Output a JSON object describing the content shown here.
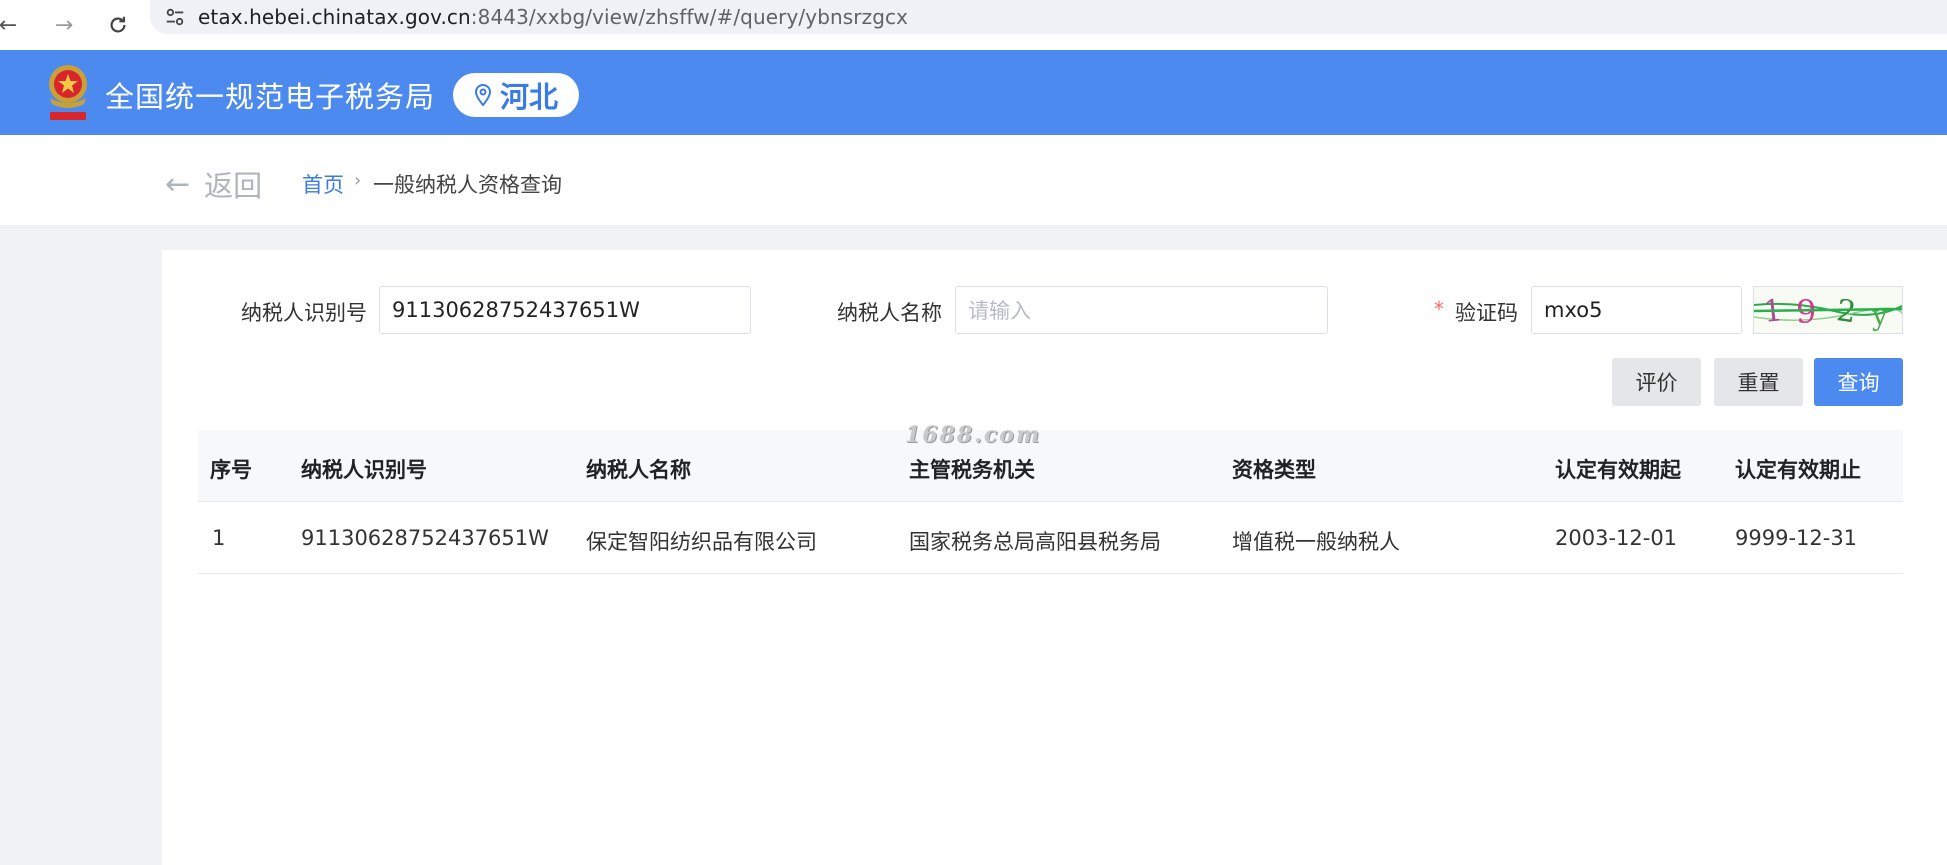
{
  "browser": {
    "url_host": "etax.hebei.chinatax.gov.cn",
    "url_path": ":8443/xxbg/view/zhsffw/#/query/ybnsrzgcx"
  },
  "header": {
    "title": "全国统一规范电子税务局",
    "region": "河北"
  },
  "breadcrumb": {
    "back_label": "返回",
    "home": "首页",
    "separator": "›",
    "current": "一般纳税人资格查询"
  },
  "form": {
    "taxpayer_id_label": "纳税人识别号",
    "taxpayer_id_value": "91130628752437651W",
    "taxpayer_name_label": "纳税人名称",
    "taxpayer_name_placeholder": "请输入",
    "captcha_required_mark": "*",
    "captcha_label": "验证码",
    "captcha_value": "mxo5",
    "captcha_image_text": "192y"
  },
  "buttons": {
    "evaluate": "评价",
    "reset": "重置",
    "query": "查询"
  },
  "watermark": "1688.com",
  "table": {
    "columns": [
      "序号",
      "纳税人识别号",
      "纳税人名称",
      "主管税务机关",
      "资格类型",
      "认定有效期起",
      "认定有效期止"
    ],
    "rows": [
      [
        "1",
        "91130628752437651W",
        "保定智阳纺织品有限公司",
        "国家税务总局高阳县税务局",
        "增值税一般纳税人",
        "2003-12-01",
        "9999-12-31"
      ]
    ]
  },
  "colors": {
    "brand_blue": "#4d8af0",
    "required_red": "#f56c6c",
    "link_blue": "#3a7be6"
  }
}
